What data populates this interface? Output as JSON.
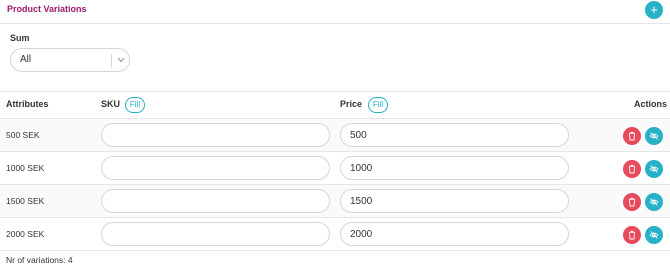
{
  "header": {
    "title": "Product Variations",
    "add_label": "+"
  },
  "sum": {
    "label": "Sum",
    "selected": "All"
  },
  "table": {
    "columns": {
      "attributes": "Attributes",
      "sku": "SKU",
      "price": "Price",
      "actions": "Actions"
    },
    "fill_label": "Fill",
    "rows": [
      {
        "attribute": "500 SEK",
        "sku": "",
        "price": "500"
      },
      {
        "attribute": "1000 SEK",
        "sku": "",
        "price": "1000"
      },
      {
        "attribute": "1500 SEK",
        "sku": "",
        "price": "1500"
      },
      {
        "attribute": "2000 SEK",
        "sku": "",
        "price": "2000"
      }
    ]
  },
  "footer": {
    "count_text": "Nr of variations: 4"
  },
  "colors": {
    "accent": "#27b1c6",
    "title": "#9c1c6b",
    "delete": "#e64a5b"
  },
  "icons": {
    "add": "plus-icon",
    "select": "chevron-down-icon",
    "delete": "trash-icon",
    "hide": "eye-slash-icon"
  }
}
